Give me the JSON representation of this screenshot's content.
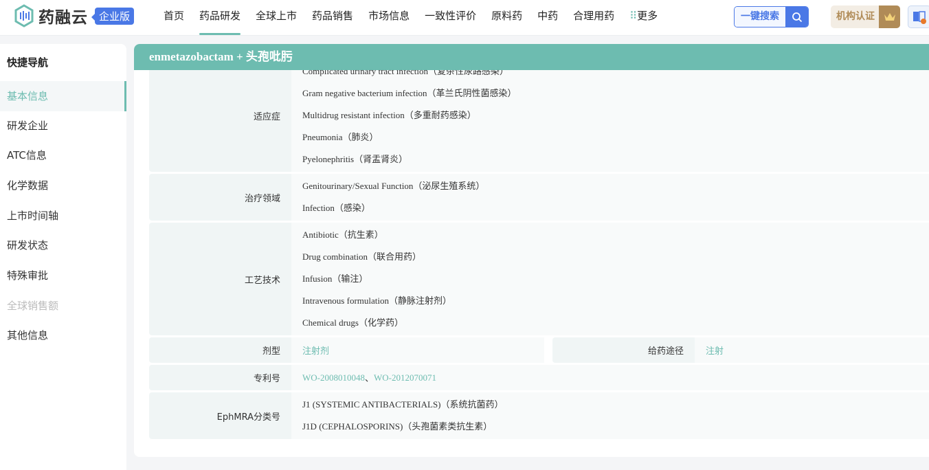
{
  "header": {
    "logo_text": "药融云",
    "edition_badge": "企业版",
    "nav": [
      "首页",
      "药品研发",
      "全球上市",
      "药品销售",
      "市场信息",
      "一致性评价",
      "原料药",
      "中药",
      "合理用药",
      "更多"
    ],
    "active_nav": "药品研发",
    "search_label": "一键搜索",
    "cert_label": "机构认证"
  },
  "sidebar": {
    "title": "快捷导航",
    "items": [
      {
        "label": "基本信息",
        "state": "active"
      },
      {
        "label": "研发企业"
      },
      {
        "label": "ATC信息"
      },
      {
        "label": "化学数据"
      },
      {
        "label": "上市时间轴"
      },
      {
        "label": "研发状态"
      },
      {
        "label": "特殊审批"
      },
      {
        "label": "全球销售额",
        "state": "disabled"
      },
      {
        "label": "其他信息"
      }
    ]
  },
  "main": {
    "title": "enmetazobactam + 头孢吡肟",
    "rows": {
      "indications": {
        "label": "适应症",
        "values": [
          "Complicated urinary tract infection（复杂性尿路感染）",
          "Gram negative bacterium infection（革兰氏阴性菌感染）",
          "Multidrug resistant infection（多重耐药感染）",
          "Pneumonia（肺炎）",
          "Pyelonephritis（肾盂肾炎）"
        ]
      },
      "therapeutic_area": {
        "label": "治疗领域",
        "values": [
          "Genitourinary/Sexual Function（泌尿生殖系统）",
          "Infection（感染）"
        ]
      },
      "technology": {
        "label": "工艺技术",
        "values": [
          "Antibiotic（抗生素）",
          "Drug combination（联合用药）",
          "Infusion（输注）",
          "Intravenous formulation（静脉注射剂）",
          "Chemical drugs（化学药）"
        ]
      },
      "dosage_form": {
        "label": "剂型",
        "value": "注射剂"
      },
      "route": {
        "label": "给药途径",
        "value": "注射"
      },
      "patent": {
        "label": "专利号",
        "values": [
          "WO-2008010048",
          "WO-2012070071"
        ],
        "separator": "、"
      },
      "ephmra": {
        "label": "EphMRA分类号",
        "values": [
          "J1 (SYSTEMIC ANTIBACTERIALS)（系统抗菌药）",
          "J1D (CEPHALOSPORINS)（头孢菌素类抗生素）"
        ]
      }
    }
  },
  "colors": {
    "accent": "#6dbcb0",
    "blue": "#4a78e6",
    "gold": "#b08b57"
  }
}
